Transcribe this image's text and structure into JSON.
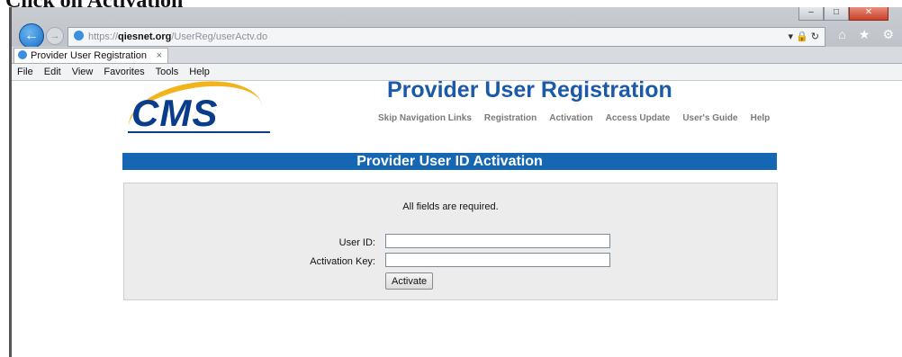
{
  "caption": "Click on Activation",
  "browser": {
    "address": {
      "scheme": "https://",
      "host": "qiesnet.org",
      "path": "/UserReg/userActv.do"
    },
    "tab": {
      "label": "Provider User Registration",
      "close": "×"
    },
    "menu": [
      "File",
      "Edit",
      "View",
      "Favorites",
      "Tools",
      "Help"
    ]
  },
  "page": {
    "logo_text": "CMS",
    "title": "Provider User Registration",
    "nav": [
      "Skip Navigation Links",
      "Registration",
      "Activation",
      "Access Update",
      "User's Guide",
      "Help"
    ],
    "section_header": "Provider User ID Activation",
    "form": {
      "note": "All fields are required.",
      "user_id_label": "User ID:",
      "user_id_value": "",
      "activation_key_label": "Activation Key:",
      "activation_key_value": "",
      "submit_label": "Activate"
    }
  },
  "colors": {
    "header_blue": "#1566b3",
    "title_blue": "#1a5aa8",
    "logo_blue": "#0a3c8c",
    "logo_gold": "#f2b31b"
  }
}
